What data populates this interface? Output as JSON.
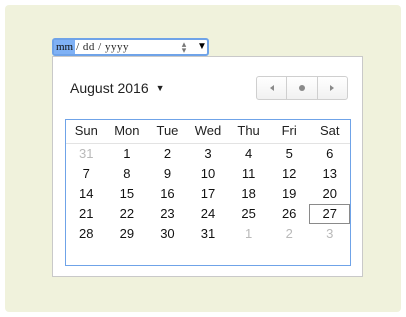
{
  "date_input": {
    "month": "mm",
    "rest": " / dd / yyyy",
    "spinner_up": "▴",
    "spinner_down": "▾",
    "dropdown": "▼"
  },
  "calendar": {
    "month_label": "August 2016",
    "nav": {
      "prev": "previous month",
      "today": "today",
      "next": "next month"
    },
    "weekdays": [
      "Sun",
      "Mon",
      "Tue",
      "Wed",
      "Thu",
      "Fri",
      "Sat"
    ],
    "weeks": [
      [
        {
          "d": "31",
          "m": true
        },
        {
          "d": "1"
        },
        {
          "d": "2"
        },
        {
          "d": "3"
        },
        {
          "d": "4"
        },
        {
          "d": "5"
        },
        {
          "d": "6"
        }
      ],
      [
        {
          "d": "7"
        },
        {
          "d": "8"
        },
        {
          "d": "9"
        },
        {
          "d": "10"
        },
        {
          "d": "11"
        },
        {
          "d": "12"
        },
        {
          "d": "13"
        }
      ],
      [
        {
          "d": "14"
        },
        {
          "d": "15"
        },
        {
          "d": "16"
        },
        {
          "d": "17"
        },
        {
          "d": "18"
        },
        {
          "d": "19"
        },
        {
          "d": "20"
        }
      ],
      [
        {
          "d": "21"
        },
        {
          "d": "22"
        },
        {
          "d": "23"
        },
        {
          "d": "24"
        },
        {
          "d": "25"
        },
        {
          "d": "26"
        },
        {
          "d": "27",
          "today": true
        }
      ],
      [
        {
          "d": "28"
        },
        {
          "d": "29"
        },
        {
          "d": "30"
        },
        {
          "d": "31"
        },
        {
          "d": "1",
          "m": true
        },
        {
          "d": "2",
          "m": true
        },
        {
          "d": "3",
          "m": true
        }
      ]
    ]
  }
}
